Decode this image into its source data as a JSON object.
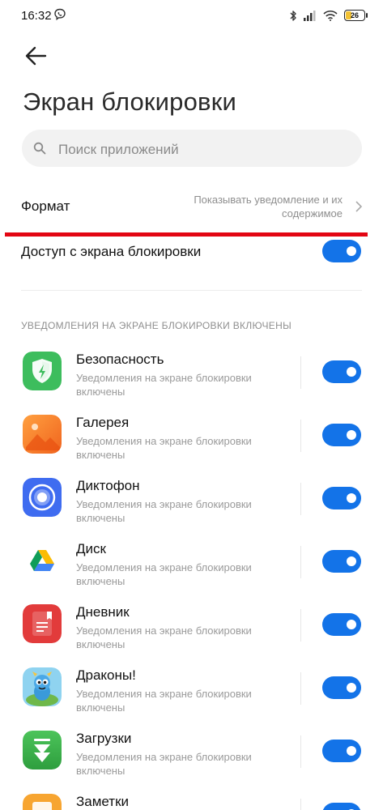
{
  "status_bar": {
    "time": "16:32",
    "battery": "26"
  },
  "page": {
    "title": "Экран блокировки"
  },
  "search": {
    "placeholder": "Поиск приложений"
  },
  "format": {
    "label": "Формат",
    "value": "Показывать уведомление и их содержимое"
  },
  "access": {
    "label": "Доступ с экрана блокировки",
    "enabled": true
  },
  "section": {
    "header": "УВЕДОМЛЕНИЯ НА ЭКРАНЕ БЛОКИРОВКИ ВКЛЮЧЕНЫ"
  },
  "apps": [
    {
      "name": "Безопасность",
      "status": "Уведомления на экране блокировки включены",
      "enabled": true,
      "icon": "security-shield-icon"
    },
    {
      "name": "Галерея",
      "status": "Уведомления на экране блокировки включены",
      "enabled": true,
      "icon": "gallery-icon"
    },
    {
      "name": "Диктофон",
      "status": "Уведомления на экране блокировки включены",
      "enabled": true,
      "icon": "recorder-icon"
    },
    {
      "name": "Диск",
      "status": "Уведомления на экране блокировки включены",
      "enabled": true,
      "icon": "google-drive-icon"
    },
    {
      "name": "Дневник",
      "status": "Уведомления на экране блокировки включены",
      "enabled": true,
      "icon": "diary-icon"
    },
    {
      "name": "Драконы!",
      "status": "Уведомления на экране блокировки включены",
      "enabled": true,
      "icon": "dragons-game-icon"
    },
    {
      "name": "Загрузки",
      "status": "Уведомления на экране блокировки включены",
      "enabled": true,
      "icon": "downloads-icon"
    },
    {
      "name": "Заметки",
      "status": "",
      "enabled": true,
      "icon": "notes-icon"
    }
  ],
  "colors": {
    "accent": "#1373e8",
    "highlight_line": "#e30613"
  }
}
